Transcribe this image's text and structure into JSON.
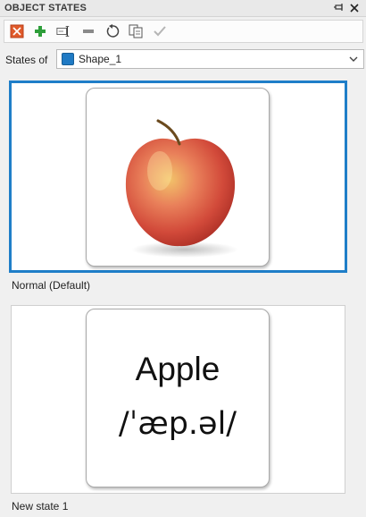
{
  "panel": {
    "title": "OBJECT STATES"
  },
  "toolbar": {
    "buttons": [
      {
        "icon": "delete-state-icon"
      },
      {
        "icon": "add-state-icon"
      },
      {
        "icon": "rename-state-icon"
      },
      {
        "icon": "remove-icon"
      },
      {
        "icon": "reset-icon"
      },
      {
        "icon": "duplicate-icon"
      },
      {
        "icon": "check-icon"
      }
    ]
  },
  "states_of": {
    "label": "States of",
    "selected": "Shape_1",
    "swatch_color": "#1f7ac4"
  },
  "states": [
    {
      "name": "Normal (Default)",
      "content": "apple-photo",
      "selected": true
    },
    {
      "name": "New state 1",
      "content_text": [
        "Apple",
        "/ˈæp.əl/"
      ],
      "selected": false
    }
  ],
  "colors": {
    "selection": "#1f7ec8",
    "add": "#2e9e3a",
    "delete": "#e05a2b"
  }
}
